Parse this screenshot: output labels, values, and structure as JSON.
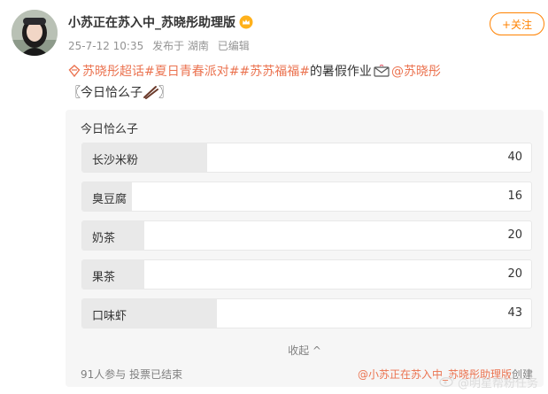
{
  "post": {
    "author": "小苏正在苏入中_苏晓彤助理版",
    "date": "25-7-12 10:35",
    "source": "发布于 湖南",
    "edited": "已编辑",
    "follow_label": "+关注",
    "content": {
      "topic1": "苏晓彤超话",
      "topic2": "#夏日青春派对#",
      "topic3": "#苏苏福福#",
      "text": " 的暑假作业",
      "mention": "@苏晓彤",
      "line2": "〖今日恰么子",
      "line2_end": "〗"
    }
  },
  "poll": {
    "title": "今日恰么子",
    "total": 91,
    "options": [
      {
        "label": "长沙米粉",
        "count": "40",
        "percent": 27.8
      },
      {
        "label": "臭豆腐",
        "count": "16",
        "percent": 11.1
      },
      {
        "label": "奶茶",
        "count": "20",
        "percent": 13.9
      },
      {
        "label": "果茶",
        "count": "20",
        "percent": 13.9
      },
      {
        "label": "口味虾",
        "count": "43",
        "percent": 29.9
      }
    ],
    "collapse_label": "收起 ^",
    "participants": "91人参与 投票已结束",
    "creator_mention": "@小苏正在苏入中_苏晓彤助理版",
    "creator_suffix": "创建"
  },
  "watermark": "@明星帮粉任务",
  "colors": {
    "accent": "#ff8200",
    "link": "#eb7350",
    "poll_bg": "#f6f6f6",
    "fill": "#e9e9e9"
  },
  "icons": [
    "avatar-photo",
    "crown-icon",
    "topic-icon",
    "envelope-icon",
    "chopsticks-icon",
    "weibo-icon"
  ]
}
